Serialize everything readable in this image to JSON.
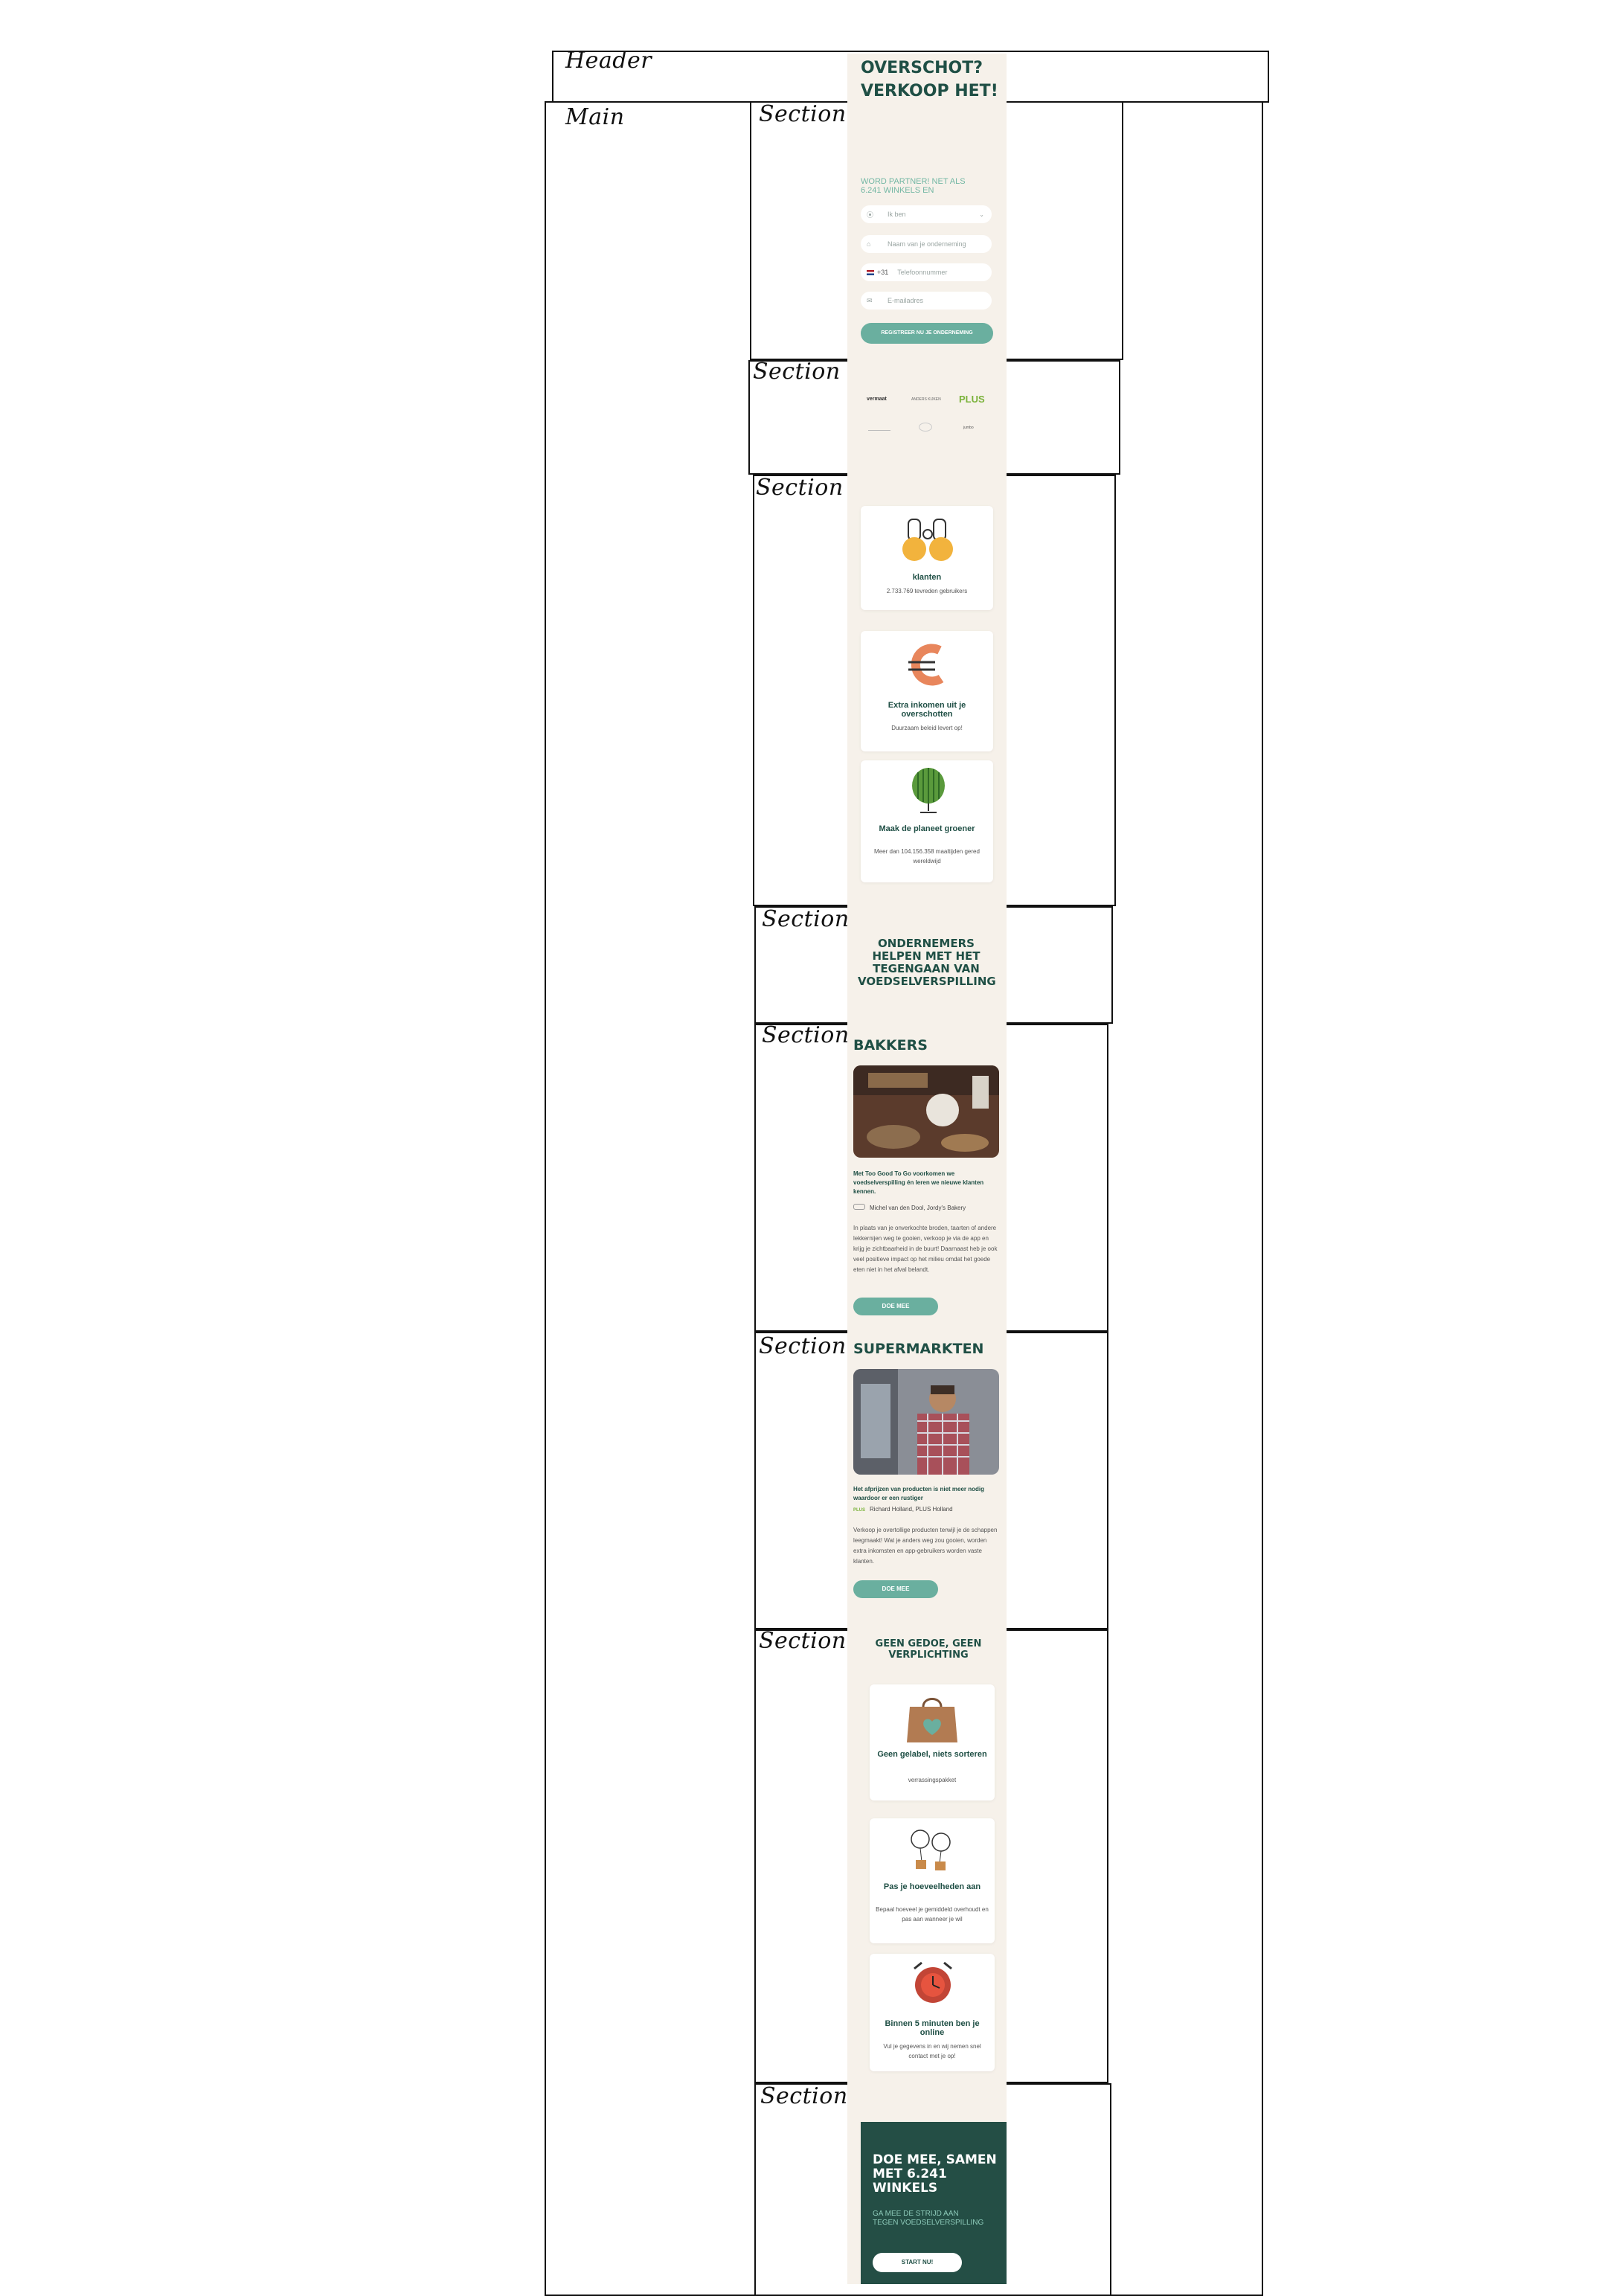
{
  "labels": {
    "header": "Header",
    "main": "Main",
    "section": "Section"
  },
  "app": {
    "hero": {
      "title": "OVERSCHOT? VERKOOP HET!",
      "subtitle": "WORD PARTNER! NET ALS 6.241 WINKELS EN",
      "fields": {
        "type": "Ik ben",
        "business": "Naam van je onderneming",
        "phone_prefix": "+31",
        "phone": "Telefoonnummer",
        "email": "E-mailadres"
      },
      "cta": "REGISTREER NU JE ONDERNEMING"
    },
    "logos": [
      "vermaat",
      "ANDERS KIJKEN",
      "PLUS",
      "",
      "",
      "jumbo"
    ],
    "benefits": [
      {
        "title": "klanten",
        "desc": "2.733.769 tevreden gebruikers",
        "icon": "binoculars-icon"
      },
      {
        "title": "Extra inkomen uit je overschotten",
        "desc": "Duurzaam beleid levert op!",
        "icon": "euro-icon"
      },
      {
        "title": "Maak de planeet groener",
        "desc": "Meer dan 104.156.358 maaltijden gered wereldwijd",
        "icon": "watermelon-globe-icon"
      }
    ],
    "mission": "ONDERNEMERS HELPEN MET HET TEGENGAAN VAN VOEDSELVERSPILLING",
    "bakers": {
      "title": "BAKKERS",
      "quote": "Met Too Good To Go voorkomen we voedselverspilling én leren we nieuwe klanten kennen.",
      "author": "Michel van den Dool, Jordy's Bakery",
      "body": "In plaats van je onverkochte broden, taarten of andere lekkernijen weg te gooien, verkoop je via de app en krijg je zichtbaarheid in de buurt! Daarnaast heb je ook veel positieve impact op het milieu omdat het goede eten niet in het afval belandt.",
      "cta": "DOE MEE"
    },
    "supermarkets": {
      "title": "SUPERMARKTEN",
      "quote": "Het afprijzen van producten is niet meer nodig waardoor er een rustiger",
      "author": "Richard Holland, PLUS Holland",
      "author_logo": "PLUS",
      "body": "Verkoop je overtollige producten terwijl je de schappen leegmaakt! Wat je anders weg zou gooien, worden extra inkomsten en app-gebruikers worden vaste klanten.",
      "cta": "DOE MEE"
    },
    "easy": {
      "title": "GEEN GEDOE, GEEN VERPLICHTING",
      "cards": [
        {
          "title": "Geen gelabel, niets sorteren",
          "desc": "verrassingspakket",
          "icon": "shopping-bag-icon"
        },
        {
          "title": "Pas je hoeveelheden aan",
          "desc": "Bepaal hoeveel je gemiddeld overhoudt en pas aan wanneer je wil",
          "icon": "balloons-icon"
        },
        {
          "title": "Binnen 5 minuten ben je online",
          "desc": "Vul je gegevens in en wij nemen snel contact met je op!",
          "icon": "alarm-clock-icon"
        }
      ]
    },
    "final": {
      "title": "DOE MEE, SAMEN MET 6.241 WINKELS",
      "subtitle": "GA MEE DE STRIJD AAN TEGEN VOEDSELVERSPILLING",
      "cta": "START NU!"
    }
  }
}
